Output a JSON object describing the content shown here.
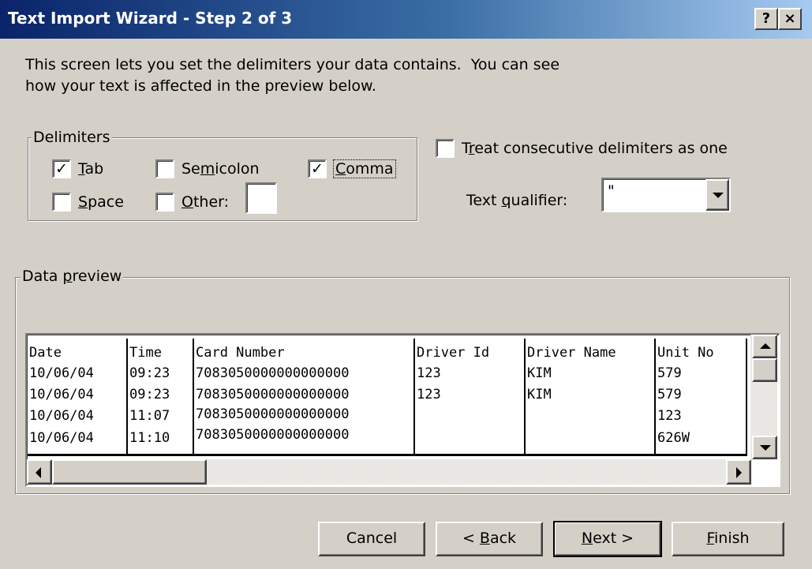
{
  "window": {
    "title": "Text Import Wizard - Step 2 of 3",
    "help_label": "?",
    "close_label": "×"
  },
  "intro": {
    "line1": "This screen lets you set the delimiters your data contains.  You can see",
    "line2": "how your text is affected in the preview below."
  },
  "delimiters": {
    "label": "Delimiters",
    "tab": {
      "label": "Tab",
      "checked": true
    },
    "semicolon": {
      "label": "Semicolon",
      "checked": false
    },
    "comma": {
      "label": "Comma",
      "checked": true
    },
    "space": {
      "label": "Space",
      "checked": false
    },
    "other": {
      "label": "Other:",
      "checked": false,
      "value": ""
    }
  },
  "options": {
    "consecutive": {
      "label": "Treat consecutive delimiters as one",
      "checked": false
    },
    "qualifier_label": "Text qualifier:",
    "qualifier_value": "\""
  },
  "preview": {
    "label": "Data preview",
    "columns": [
      {
        "header": "Date",
        "cells": [
          "10/06/04",
          "10/06/04",
          "10/06/04",
          "10/06/04"
        ]
      },
      {
        "header": "Time",
        "cells": [
          "09:23",
          "09:23",
          "11:07",
          "11:10"
        ]
      },
      {
        "header": "Card Number",
        "cells": [
          "7083050000000000000",
          "7083050000000000000",
          "7083050000000000000",
          "7083050000000000000"
        ]
      },
      {
        "header": "Driver Id",
        "cells": [
          "123",
          "123",
          "",
          ""
        ]
      },
      {
        "header": "Driver Name",
        "cells": [
          "KIM",
          "KIM",
          "",
          ""
        ]
      },
      {
        "header": "Unit No",
        "cells": [
          "579",
          "579",
          "123",
          "626W"
        ]
      }
    ]
  },
  "buttons": {
    "cancel": "Cancel",
    "back": "< Back",
    "next": "Next >",
    "finish": "Finish"
  },
  "colors": {
    "title_gradient_start": "#0a246a",
    "title_gradient_end": "#a6caf0",
    "face": "#d4d0c8"
  }
}
